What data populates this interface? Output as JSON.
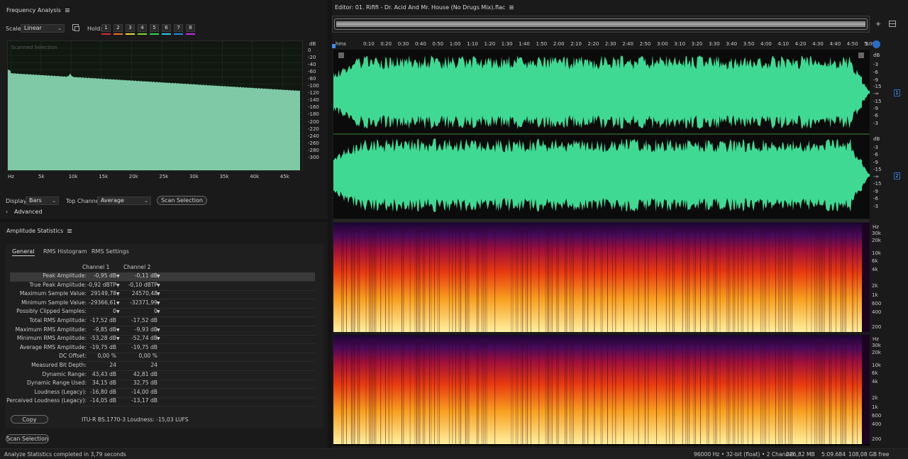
{
  "freq": {
    "title": "Frequency Analysis",
    "scale_label": "Scale:",
    "scale_value": "Linear",
    "hold_label": "Hold:",
    "hold_buttons": [
      "1",
      "2",
      "3",
      "4",
      "5",
      "6",
      "7",
      "8"
    ],
    "hold_colors": [
      "#e0282a",
      "#e8742a",
      "#e8d82a",
      "#7ad82a",
      "#2ad85a",
      "#2ac8e8",
      "#2a8ae8",
      "#c82ae8"
    ],
    "overlay_text": "Scanned Selection",
    "db_unit": "dB",
    "db_ticks": [
      "0",
      "-20",
      "-40",
      "-60",
      "-80",
      "-100",
      "-120",
      "-140",
      "-160",
      "-180",
      "-200",
      "-220",
      "-240",
      "-260",
      "-280",
      "-300"
    ],
    "hz_unit": "Hz",
    "hz_ticks": [
      "5k",
      "10k",
      "15k",
      "20k",
      "25k",
      "30k",
      "35k",
      "40k",
      "45k"
    ],
    "display_label": "Display:",
    "display_value": "Bars",
    "top_channel_label": "Top Channel:",
    "top_channel_value": "Average",
    "scan_button": "Scan Selection",
    "advanced_label": "Advanced",
    "spectrum_color": "#7fc9a6"
  },
  "amp": {
    "title": "Amplitude Statistics",
    "tabs": [
      "General",
      "RMS Histogram",
      "RMS Settings"
    ],
    "col1": "Channel 1",
    "col2": "Channel 2",
    "rows": [
      {
        "label": "Peak Amplitude:",
        "c1": "-0,95 dB",
        "c2": "-0,11 dB",
        "pin": true
      },
      {
        "label": "True Peak Amplitude:",
        "c1": "-0,92 dBTP",
        "c2": "-0,10 dBTP",
        "pin": true
      },
      {
        "label": "Maximum Sample Value:",
        "c1": "29149,78",
        "c2": "24570,48",
        "pin": true
      },
      {
        "label": "Minimum Sample Value:",
        "c1": "-29366,61",
        "c2": "-32371,99",
        "pin": true
      },
      {
        "label": "Possibly Clipped Samples:",
        "c1": "0",
        "c2": "0",
        "pin": true
      },
      {
        "label": "Total RMS Amplitude:",
        "c1": "-17,52 dB",
        "c2": "-17,52 dB",
        "pin": false
      },
      {
        "label": "Maximum RMS Amplitude:",
        "c1": "-9,85 dB",
        "c2": "-9,93 dB",
        "pin": true
      },
      {
        "label": "Minimum RMS Amplitude:",
        "c1": "-53,28 dB",
        "c2": "-52,74 dB",
        "pin": true
      },
      {
        "label": "Average RMS Amplitude:",
        "c1": "-19,75 dB",
        "c2": "-19,75 dB",
        "pin": false
      },
      {
        "label": "DC Offset:",
        "c1": "0,00 %",
        "c2": "0,00 %",
        "pin": false
      },
      {
        "label": "Measured Bit Depth:",
        "c1": "24",
        "c2": "24",
        "pin": false
      },
      {
        "label": "Dynamic Range:",
        "c1": "43,43 dB",
        "c2": "42,81 dB",
        "pin": false
      },
      {
        "label": "Dynamic Range Used:",
        "c1": "34,15 dB",
        "c2": "32,75 dB",
        "pin": false
      },
      {
        "label": "Loudness (Legacy):",
        "c1": "-16,80 dB",
        "c2": "-14,00 dB",
        "pin": false
      },
      {
        "label": "Perceived Loudness (Legacy):",
        "c1": "-14,05 dB",
        "c2": "-13,17 dB",
        "pin": false
      }
    ],
    "copy_button": "Copy",
    "lufs_text": "ITU-R BS.1770-3 Loudness: -15,03 LUFS",
    "scan_button": "Scan Selection"
  },
  "editor": {
    "title": "Editor: 01. Rififi - Dr. Acid And Mr. House (No Drugs Mix).flac",
    "ruler_ticks": [
      "hms",
      "0:10",
      "0:20",
      "0:30",
      "0:40",
      "0:50",
      "1:00",
      "1:10",
      "1:20",
      "1:30",
      "1:40",
      "1:50",
      "2:00",
      "2:10",
      "2:20",
      "2:30",
      "2:40",
      "2:50",
      "3:00",
      "3:10",
      "3:20",
      "3:30",
      "3:40",
      "3:50",
      "4:00",
      "4:10",
      "4:20",
      "4:30",
      "4:40",
      "4:50",
      "5:00",
      "5"
    ],
    "wave_db_labels": [
      "dB",
      "-3",
      "-6",
      "-9",
      "-15",
      "-∞",
      "-15",
      "-9",
      "-6",
      "-3"
    ],
    "channel_labels": [
      "1",
      "2"
    ],
    "spec_hz_labels": [
      "Hz",
      "30k",
      "20k",
      "10k",
      "6k",
      "4k",
      "2k",
      "1k",
      "600",
      "400",
      "200"
    ],
    "wave_color": "#3fd993"
  },
  "status": {
    "left": "Analyze Statistics completed in 3,79 seconds",
    "format": "96000 Hz • 32-bit (float) • 2 Channel",
    "size": "226,82 MB",
    "duration": "5:09.684",
    "free": "108,08 GB free"
  }
}
